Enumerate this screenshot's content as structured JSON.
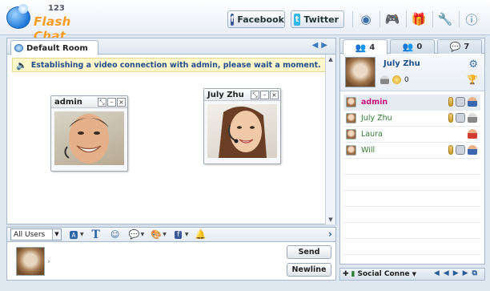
{
  "header": {
    "logo_number": "123",
    "logo_text": "Flash Chat",
    "facebook_label": "Facebook",
    "twitter_label": "Twitter"
  },
  "room": {
    "tab_label": "Default Room",
    "notice": "Establishing a video connection with admin, please wait a moment."
  },
  "videos": [
    {
      "title": "admin"
    },
    {
      "title": "July Zhu"
    }
  ],
  "composer": {
    "target_select": "All Users",
    "send_label": "Send",
    "newline_label": "Newline"
  },
  "user_panel": {
    "tabs": [
      {
        "count": "4"
      },
      {
        "count": "0"
      },
      {
        "count": "7"
      }
    ],
    "me": {
      "name": "July Zhu",
      "credits": "0"
    },
    "users": [
      {
        "name": "admin",
        "color": "#c8107e"
      },
      {
        "name": "July Zhu",
        "color": "#2e7d32"
      },
      {
        "name": "Laura",
        "color": "#2e7d32"
      },
      {
        "name": "Will",
        "color": "#2e7d32"
      }
    ]
  },
  "status_bar": {
    "label": "Social Conne"
  },
  "colors": {
    "accent": "#3b6fae",
    "logo_orange": "#ff9a1e",
    "notice_bg": "#fff6c9"
  }
}
